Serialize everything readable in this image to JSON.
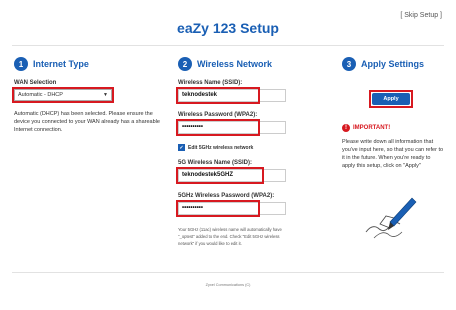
{
  "header": {
    "skip_label": "[ Skip Setup ]",
    "title": "eaZy 123 Setup"
  },
  "steps": [
    {
      "number": "1",
      "label": "Internet Type"
    },
    {
      "number": "2",
      "label": "Wireless Network"
    },
    {
      "number": "3",
      "label": "Apply Settings"
    }
  ],
  "internet": {
    "wan_label": "WAN Selection",
    "wan_value": "Automatic - DHCP",
    "description": "Automatic (DHCP) has been selected. Please ensure the device you connected to your WAN already has a shareable Internet connection."
  },
  "wireless": {
    "ssid_label": "Wireless Name (SSID):",
    "ssid_value": "teknodestek",
    "password_label": "Wireless Password (WPA2):",
    "password_value": "••••••••••",
    "edit5g_label": "Edit 5GHz wireless network",
    "ssid5g_label": "5G Wireless Name (SSID):",
    "ssid5g_value": "teknodestek5GHZ",
    "password5g_label": "5GHz Wireless Password (WPA2):",
    "password5g_value": "••••••••••",
    "note": "Your 5GHz (11ac) wireless name will automatically have \"_optest\" added to the end. Check \"Edit 5GHz wireless network\" if you would like to edit it."
  },
  "apply": {
    "button_label": "Apply",
    "important_label": "IMPORTANT!",
    "important_text": "Please write down all information that you've input here, so that you can refer to it in the future. When you're ready to apply this setup, click on \"Apply\""
  },
  "footer": {
    "text": "Zyxel Communications (C)"
  },
  "colors": {
    "accent": "#1a5fb4",
    "highlight": "#d71920"
  }
}
